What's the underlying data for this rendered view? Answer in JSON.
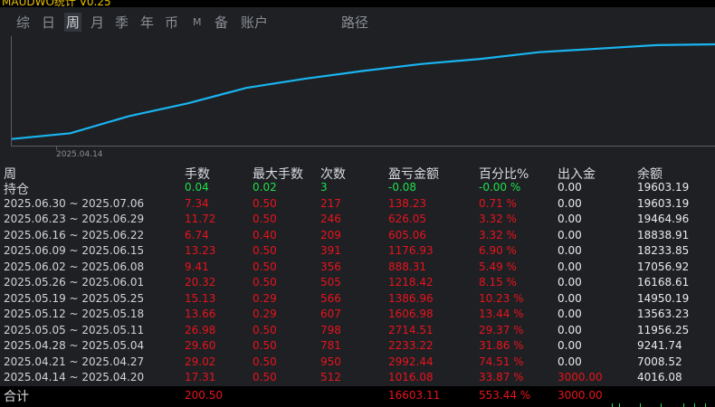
{
  "app": {
    "title": "MAUDWO统计 V0.25"
  },
  "tabs": [
    {
      "label": "综",
      "active": false
    },
    {
      "label": "日",
      "active": false
    },
    {
      "label": "周",
      "active": true
    },
    {
      "label": "月",
      "active": false
    },
    {
      "label": "季",
      "active": false
    },
    {
      "label": "年",
      "active": false
    },
    {
      "label": "币",
      "active": false
    },
    {
      "label": "M",
      "active": false
    },
    {
      "label": "备",
      "active": false
    },
    {
      "label": "账户",
      "active": false
    },
    {
      "label": "路径",
      "active": false
    }
  ],
  "chart_data": {
    "type": "line",
    "x_tick_label": "2025.04.14",
    "x": [
      "2025.04.14",
      "2025.04.21",
      "2025.04.28",
      "2025.05.05",
      "2025.05.12",
      "2025.05.19",
      "2025.05.26",
      "2025.06.02",
      "2025.06.09",
      "2025.06.16",
      "2025.06.23",
      "2025.06.30"
    ],
    "series": [
      {
        "values": [
          4016.08,
          7008.52,
          9241.74,
          11956.25,
          13563.23,
          14950.19,
          16168.61,
          17056.92,
          18233.85,
          18838.91,
          19464.96,
          19603.19
        ],
        "color": "#1ab4f0"
      }
    ]
  },
  "table": {
    "headers": [
      "周",
      "手数",
      "最大手数",
      "次数",
      "盈亏金额",
      "百分比%",
      "出入金",
      "余额"
    ],
    "holding": {
      "label": "持仓",
      "lots": "0.04",
      "max_lots": "0.02",
      "count": "3",
      "pnl": "-0.08",
      "pct": "-0.00 %",
      "flow": "0.00",
      "balance": "19603.19"
    },
    "rows": [
      {
        "period": "2025.06.30 ~ 2025.07.06",
        "lots": "7.34",
        "max_lots": "0.50",
        "count": "217",
        "pnl": "138.23",
        "pct": "0.71 %",
        "flow": "0.00",
        "balance": "19603.19"
      },
      {
        "period": "2025.06.23 ~ 2025.06.29",
        "lots": "11.72",
        "max_lots": "0.50",
        "count": "246",
        "pnl": "626.05",
        "pct": "3.32 %",
        "flow": "0.00",
        "balance": "19464.96"
      },
      {
        "period": "2025.06.16 ~ 2025.06.22",
        "lots": "6.74",
        "max_lots": "0.40",
        "count": "209",
        "pnl": "605.06",
        "pct": "3.32 %",
        "flow": "0.00",
        "balance": "18838.91"
      },
      {
        "period": "2025.06.09 ~ 2025.06.15",
        "lots": "13.23",
        "max_lots": "0.50",
        "count": "391",
        "pnl": "1176.93",
        "pct": "6.90 %",
        "flow": "0.00",
        "balance": "18233.85"
      },
      {
        "period": "2025.06.02 ~ 2025.06.08",
        "lots": "9.41",
        "max_lots": "0.50",
        "count": "356",
        "pnl": "888.31",
        "pct": "5.49 %",
        "flow": "0.00",
        "balance": "17056.92"
      },
      {
        "period": "2025.05.26 ~ 2025.06.01",
        "lots": "20.32",
        "max_lots": "0.50",
        "count": "505",
        "pnl": "1218.42",
        "pct": "8.15 %",
        "flow": "0.00",
        "balance": "16168.61"
      },
      {
        "period": "2025.05.19 ~ 2025.05.25",
        "lots": "15.13",
        "max_lots": "0.29",
        "count": "566",
        "pnl": "1386.96",
        "pct": "10.23 %",
        "flow": "0.00",
        "balance": "14950.19"
      },
      {
        "period": "2025.05.12 ~ 2025.05.18",
        "lots": "13.66",
        "max_lots": "0.29",
        "count": "607",
        "pnl": "1606.98",
        "pct": "13.44 %",
        "flow": "0.00",
        "balance": "13563.23"
      },
      {
        "period": "2025.05.05 ~ 2025.05.11",
        "lots": "26.98",
        "max_lots": "0.50",
        "count": "798",
        "pnl": "2714.51",
        "pct": "29.37 %",
        "flow": "0.00",
        "balance": "11956.25"
      },
      {
        "period": "2025.04.28 ~ 2025.05.04",
        "lots": "29.60",
        "max_lots": "0.50",
        "count": "781",
        "pnl": "2233.22",
        "pct": "31.86 %",
        "flow": "0.00",
        "balance": "9241.74"
      },
      {
        "period": "2025.04.21 ~ 2025.04.27",
        "lots": "29.02",
        "max_lots": "0.50",
        "count": "950",
        "pnl": "2992.44",
        "pct": "74.51 %",
        "flow": "0.00",
        "balance": "7008.52"
      },
      {
        "period": "2025.04.14 ~ 2025.04.20",
        "lots": "17.31",
        "max_lots": "0.50",
        "count": "512",
        "pnl": "1016.08",
        "pct": "33.87 %",
        "flow": "3000.00",
        "balance": "4016.08"
      }
    ],
    "total": {
      "label": "合计",
      "lots": "200.50",
      "pnl": "16603.11",
      "pct": "553.44 %",
      "flow": "3000.00"
    }
  }
}
